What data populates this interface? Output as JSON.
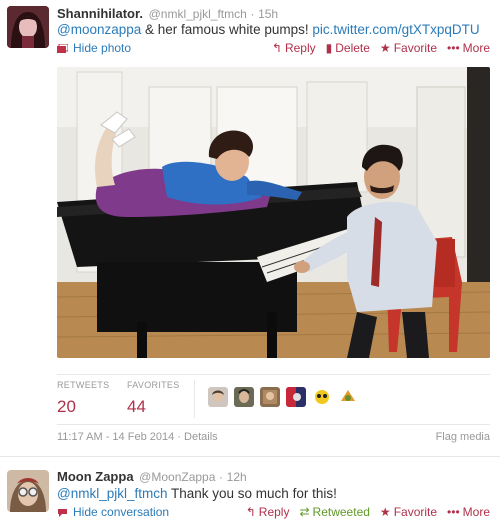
{
  "tweet1": {
    "fullname": "Shannihilator.",
    "screen_name": "@nmkl_pjkl_ftmch",
    "separator": "·",
    "time": "15h",
    "mention": "@moonzappa",
    "text": " & her famous white pumps! ",
    "link": "pic.twitter.com/gtXTxpqDTU",
    "toggle_label": "Hide photo",
    "actions": {
      "reply": "Reply",
      "delete": "Delete",
      "favorite": "Favorite",
      "more": "More"
    },
    "stats": {
      "retweets_label": "RETWEETS",
      "retweets_value": "20",
      "favorites_label": "FAVORITES",
      "favorites_value": "44"
    },
    "timestamp": "11:17 AM - 14 Feb 2014",
    "details": "Details",
    "flag": "Flag media"
  },
  "tweet2": {
    "fullname": "Moon Zappa",
    "screen_name": "@MoonZappa",
    "separator": "·",
    "time": "12h",
    "mention": "@nmkl_pjkl_ftmch",
    "text": " Thank you so much for this!",
    "toggle_label": "Hide conversation",
    "actions": {
      "reply": "Reply",
      "retweeted": "Retweeted",
      "favorite": "Favorite",
      "more": "More"
    }
  },
  "colors": {
    "link": "#2b7bb9",
    "action": "#b0314b",
    "retweeted": "#609928",
    "muted": "#999999"
  }
}
